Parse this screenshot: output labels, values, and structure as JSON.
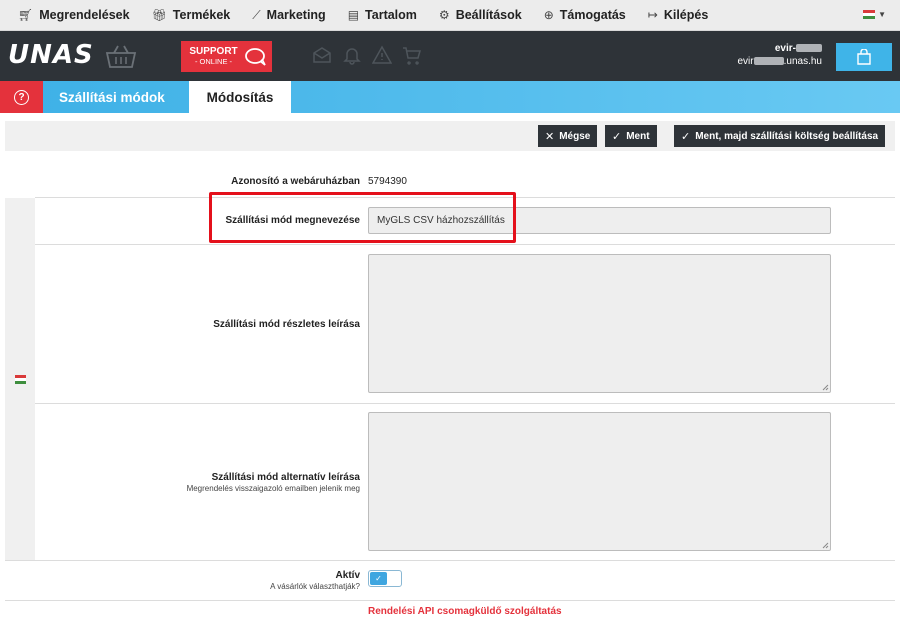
{
  "topnav": {
    "items": [
      {
        "label": "Megrendelések",
        "icon": "cart-icon"
      },
      {
        "label": "Termékek",
        "icon": "gift-icon"
      },
      {
        "label": "Marketing",
        "icon": "chart-line-icon"
      },
      {
        "label": "Tartalom",
        "icon": "document-icon"
      },
      {
        "label": "Beállítások",
        "icon": "gear-icon"
      },
      {
        "label": "Támogatás",
        "icon": "lifebuoy-icon"
      },
      {
        "label": "Kilépés",
        "icon": "logout-icon"
      }
    ],
    "language_flag": "hungarian-flag-icon"
  },
  "header": {
    "logo": "UNAS",
    "support_line1": "SUPPORT",
    "support_line2": "- ONLINE -",
    "user_line1": "evir-",
    "user_line2_prefix": "evir",
    "user_line2_suffix": ".unas.hu"
  },
  "tabs": {
    "help": "?",
    "shipping_methods": "Szállítási módok",
    "edit": "Módosítás"
  },
  "actions": {
    "cancel": "Mégse",
    "save": "Ment",
    "save_and_cost": "Ment, majd szállítási költség beállítása"
  },
  "form": {
    "webshop_id_label": "Azonosító a webáruházban",
    "webshop_id_value": "5794390",
    "name_label": "Szállítási mód megnevezése",
    "name_value": "MyGLS CSV házhozszállítás",
    "detailed_desc_label": "Szállítási mód részletes leírása",
    "alt_desc_label": "Szállítási mód alternatív leírása",
    "alt_desc_sub": "Megrendelés visszaigazoló emailben jelenik meg",
    "active_label": "Aktív",
    "active_sub": "A vásárlók választhatják?",
    "active_value": true,
    "bottom_red_text": "Rendelési API csomagküldő szolgáltatás"
  },
  "colors": {
    "accent_blue": "#3db0e6",
    "support_red": "#e4323c",
    "header_dark": "#2e3338",
    "highlight_red": "#e4101b"
  }
}
